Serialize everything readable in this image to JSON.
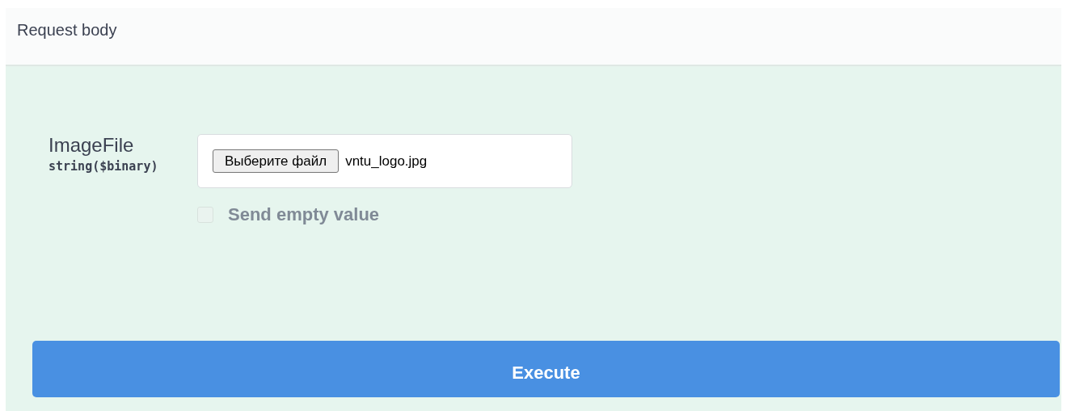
{
  "section": {
    "title": "Request body"
  },
  "parameter": {
    "name": "ImageFile",
    "type": "string($binary)",
    "file_button": "Выберите файл",
    "file_name": "vntu_logo.jpg"
  },
  "send_empty": {
    "label": "Send empty value",
    "checked": false,
    "disabled": true
  },
  "execute_button": "Execute"
}
